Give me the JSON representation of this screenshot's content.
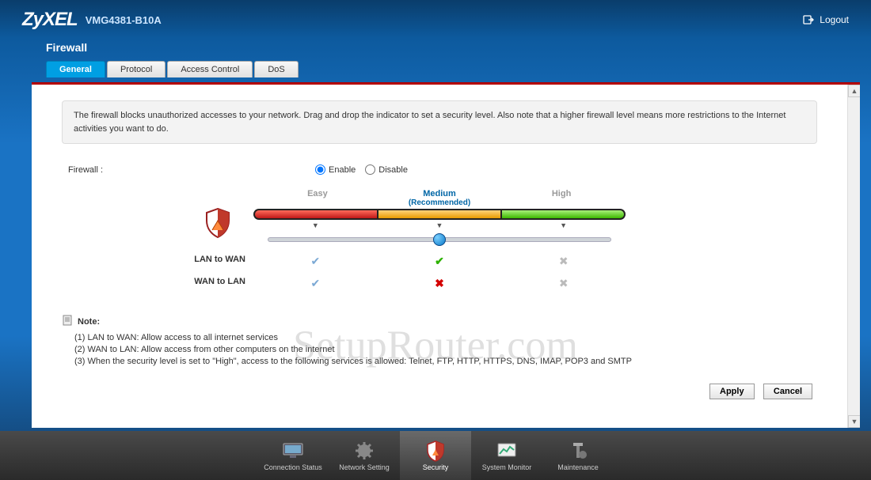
{
  "header": {
    "brand": "ZyXEL",
    "model": "VMG4381-B10A",
    "logout": "Logout"
  },
  "page": {
    "title": "Firewall"
  },
  "tabs": [
    {
      "label": "General",
      "active": true
    },
    {
      "label": "Protocol",
      "active": false
    },
    {
      "label": "Access Control",
      "active": false
    },
    {
      "label": "DoS",
      "active": false
    }
  ],
  "info": "The firewall blocks unauthorized accesses to your network. Drag and drop the indicator to set a security level. Also note that a higher firewall level means more restrictions to the Internet activities you want to do.",
  "form": {
    "firewall_label": "Firewall :",
    "enable": "Enable",
    "disable": "Disable",
    "selected": "enable"
  },
  "levels": {
    "easy": "Easy",
    "medium": "Medium",
    "medium_sub": "(Recommended)",
    "high": "High"
  },
  "matrix": {
    "row1_label": "LAN to WAN",
    "row2_label": "WAN to LAN",
    "row1": [
      "check-blue",
      "check-green",
      "x-grey"
    ],
    "row2": [
      "check-blue",
      "x-red",
      "x-grey"
    ]
  },
  "note": {
    "header": "Note:",
    "n1": "(1) LAN to WAN: Allow access to all internet services",
    "n2": "(2) WAN to LAN: Allow access from other computers on the internet",
    "n3": "(3) When the security level is set to \"High\", access to the following services is allowed: Telnet, FTP, HTTP, HTTPS, DNS, IMAP, POP3 and SMTP"
  },
  "buttons": {
    "apply": "Apply",
    "cancel": "Cancel"
  },
  "bottom_nav": [
    {
      "label": "Connection Status",
      "icon": "monitor",
      "active": false
    },
    {
      "label": "Network Setting",
      "icon": "gear",
      "active": false
    },
    {
      "label": "Security",
      "icon": "shield",
      "active": true
    },
    {
      "label": "System Monitor",
      "icon": "chart",
      "active": false
    },
    {
      "label": "Maintenance",
      "icon": "tools",
      "active": false
    }
  ],
  "watermark": "SetupRouter.com"
}
